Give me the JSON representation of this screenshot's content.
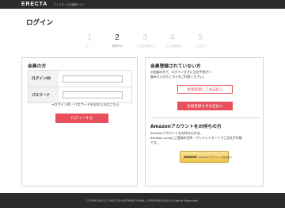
{
  "header": {
    "logo": "ERECTA",
    "tagline": "エレクター公式通販サイト"
  },
  "page": {
    "title": "ログイン"
  },
  "steps": [
    {
      "number": "1",
      "label": "カート"
    },
    {
      "number": "2",
      "label": "ログイン"
    },
    {
      "number": "3",
      "label": "ご注文者情報入力"
    },
    {
      "number": "4",
      "label": "ご注文情報確認"
    },
    {
      "number": "5",
      "label": "ご注文完了"
    }
  ],
  "member": {
    "title": "会員の方",
    "login_id_label": "ログインID",
    "password_label": "パスワード",
    "forgot_link": "→ログインID・パスワードを忘れた方はこちら",
    "login_button": "ログインする"
  },
  "guest": {
    "title": "会員登録されていない方",
    "note_line1": "※会員の方で、ログインせずに注文手続ぎへ",
    "note_line2": "進みたい方もこちらをご利用ください。",
    "register_button": "会員登録してお支払い",
    "guest_button": "会員登録せずお支払い"
  },
  "amazon": {
    "title": "Amazonアカウントをお持ちの方",
    "line1": "Amazonアカウントをお持ちの方は、",
    "line2": "Amazon.co.jpにご登録の住所・クレジットカードでご注文が可能",
    "line3": "です。",
    "button_logo": "amazon",
    "button_text": "Amazonアカウントでお支払い"
  },
  "footer": {
    "copyright": "COPYRIGHT(C) ERECTA INTERNATIONAL CORPORATION All Rights Reserved."
  },
  "colors": {
    "accent": "#e8505b",
    "header_bg": "#2b2b2b",
    "amazon_yellow": "#f2c54a"
  }
}
